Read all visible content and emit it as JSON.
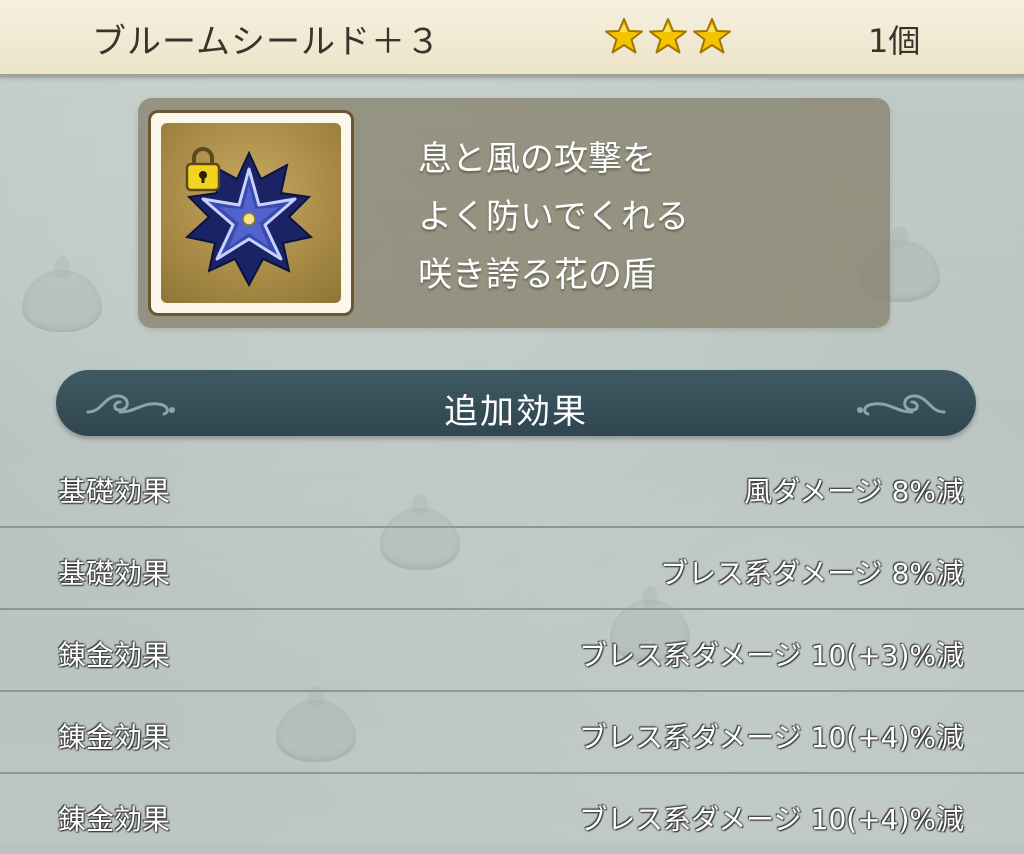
{
  "header": {
    "item_name": "ブルームシールド＋３",
    "rarity_stars": 3,
    "count": "1個"
  },
  "item": {
    "icon": "bloom-shield-icon",
    "locked": true,
    "description_lines": [
      "息と風の攻撃を",
      "よく防いでくれる",
      "咲き誇る花の盾"
    ]
  },
  "section": {
    "title": "追加効果"
  },
  "effects": [
    {
      "label": "基礎効果",
      "value": "風ダメージ 8%減"
    },
    {
      "label": "基礎効果",
      "value": "ブレス系ダメージ 8%減"
    },
    {
      "label": "錬金効果",
      "value": "ブレス系ダメージ 10(+3)%減"
    },
    {
      "label": "錬金効果",
      "value": "ブレス系ダメージ 10(+4)%減"
    },
    {
      "label": "錬金効果",
      "value": "ブレス系ダメージ 10(+4)%減"
    }
  ],
  "colors": {
    "header_bg": "#f1e9d3",
    "banner_bg": "#354d57",
    "star": "#f2c000"
  }
}
